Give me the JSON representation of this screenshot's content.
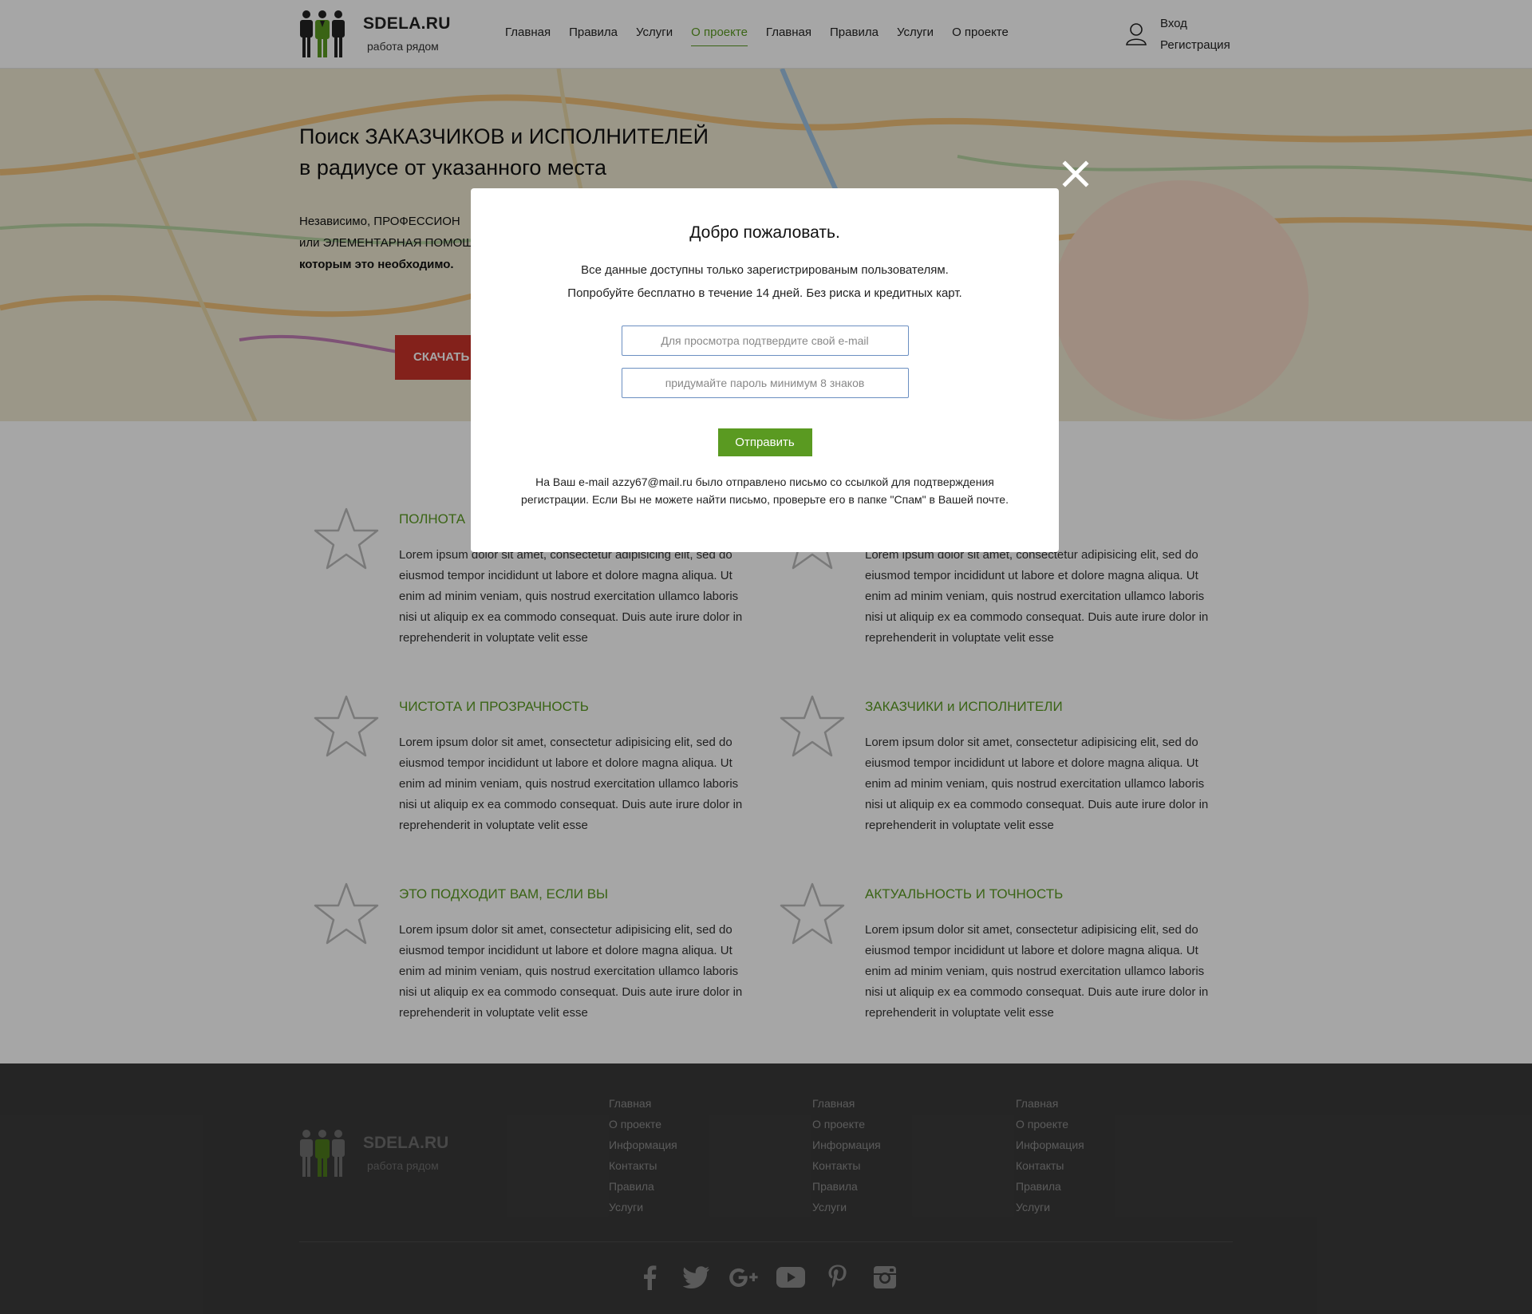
{
  "header": {
    "logo_name": "SDELA.RU",
    "logo_tagline": "работа рядом",
    "nav": [
      {
        "label": "Главная",
        "active": false
      },
      {
        "label": "Правила",
        "active": false
      },
      {
        "label": "Услуги",
        "active": false
      },
      {
        "label": "О проекте",
        "active": true
      },
      {
        "label": "Главная",
        "active": false
      },
      {
        "label": "Правила",
        "active": false
      },
      {
        "label": "Услуги",
        "active": false
      },
      {
        "label": "О проекте",
        "active": false
      }
    ],
    "login_label": "Вход",
    "register_label": "Регистрация",
    "user_icon": "user-icon"
  },
  "hero": {
    "title_line1": "Поиск ЗАКАЗЧИКОВ и ИСПОЛНИТЕЛЕЙ",
    "title_line2": "в радиусе от указанного места",
    "text_line1": "Независимо, ПРОФЕССИОН",
    "text_line2": "или ЭЛЕМЕНТАРНАЯ ПОМОЩ",
    "text_line3": "которым это необходимо.",
    "button_label": "СКАЧАТЬ"
  },
  "features": [
    {
      "title": "ПОЛНОТА",
      "text": "Lorem ipsum dolor sit amet, consectetur adipisicing elit, sed do eiusmod tempor incididunt ut labore et dolore magna aliqua. Ut enim ad minim veniam, quis nostrud exercitation ullamco laboris nisi ut aliquip ex ea commodo consequat. Duis aute irure dolor in reprehenderit in voluptate velit esse"
    },
    {
      "title": "",
      "text": "Lorem ipsum dolor sit amet, consectetur adipisicing elit, sed do eiusmod tempor incididunt ut labore et dolore magna aliqua. Ut enim ad minim veniam, quis nostrud exercitation ullamco laboris nisi ut aliquip ex ea commodo consequat. Duis aute irure dolor in reprehenderit in voluptate velit esse"
    },
    {
      "title": "ЧИСТОТА И ПРОЗРАЧНОСТЬ",
      "text": "Lorem ipsum dolor sit amet, consectetur adipisicing elit, sed do eiusmod tempor incididunt ut labore et dolore magna aliqua. Ut enim ad minim veniam, quis nostrud exercitation ullamco laboris nisi ut aliquip ex ea commodo consequat. Duis aute irure dolor in reprehenderit in voluptate velit esse"
    },
    {
      "title": "ЗАКАЗЧИКИ и ИСПОЛНИТЕЛИ",
      "text": "Lorem ipsum dolor sit amet, consectetur adipisicing elit, sed do eiusmod tempor incididunt ut labore et dolore magna aliqua. Ut enim ad minim veniam, quis nostrud exercitation ullamco laboris nisi ut aliquip ex ea commodo consequat. Duis aute irure dolor in reprehenderit in voluptate velit esse"
    },
    {
      "title": "ЭТО ПОДХОДИТ ВАМ, ЕСЛИ ВЫ",
      "text": "Lorem ipsum dolor sit amet, consectetur adipisicing elit, sed do eiusmod tempor incididunt ut labore et dolore magna aliqua. Ut enim ad minim veniam, quis nostrud exercitation ullamco laboris nisi ut aliquip ex ea commodo consequat. Duis aute irure dolor in reprehenderit in voluptate velit esse"
    },
    {
      "title": "АКТУАЛЬНОСТЬ И ТОЧНОСТЬ",
      "text": "Lorem ipsum dolor sit amet, consectetur adipisicing elit, sed do eiusmod tempor incididunt ut labore et dolore magna aliqua. Ut enim ad minim veniam, quis nostrud exercitation ullamco laboris nisi ut aliquip ex ea commodo consequat. Duis aute irure dolor in reprehenderit in voluptate velit esse"
    }
  ],
  "footer": {
    "logo_name": "SDELA.RU",
    "logo_tagline": "работа рядом",
    "columns": [
      [
        "Главная",
        "О проекте",
        "Информация",
        "Контакты",
        "Правила",
        "Услуги"
      ],
      [
        "Главная",
        "О проекте",
        "Информация",
        "Контакты",
        "Правила",
        "Услуги"
      ],
      [
        "Главная",
        "О проекте",
        "Информация",
        "Контакты",
        "Правила",
        "Услуги"
      ]
    ],
    "socials": [
      "facebook-icon",
      "twitter-icon",
      "google-plus-icon",
      "youtube-icon",
      "pinterest-icon",
      "instagram-icon"
    ]
  },
  "modal": {
    "title": "Добро пожаловать.",
    "subtitle_line1": "Все данные доступны только зарегистрированым пользователям.",
    "subtitle_line2": "Попробуйте бесплатно в течение 14 дней. Без риска и кредитных карт.",
    "email_placeholder": "Для просмотра подтвердите свой e-mail",
    "password_placeholder": "придумайте пароль минимум 8 знаков",
    "submit_label": "Отправить",
    "note": "На Ваш e-mail azzy67@mail.ru было отправлено письмо со ссылкой для подтверждения регистрации. Если Вы не можете найти письмо, проверьте его в папке \"Спам\" в Вашей почте."
  },
  "colors": {
    "brand_green": "#5a9a21",
    "button_red": "#c9332a",
    "footer_bg": "#3a3a3a",
    "overlay": "rgba(0,0,0,0.35)"
  }
}
